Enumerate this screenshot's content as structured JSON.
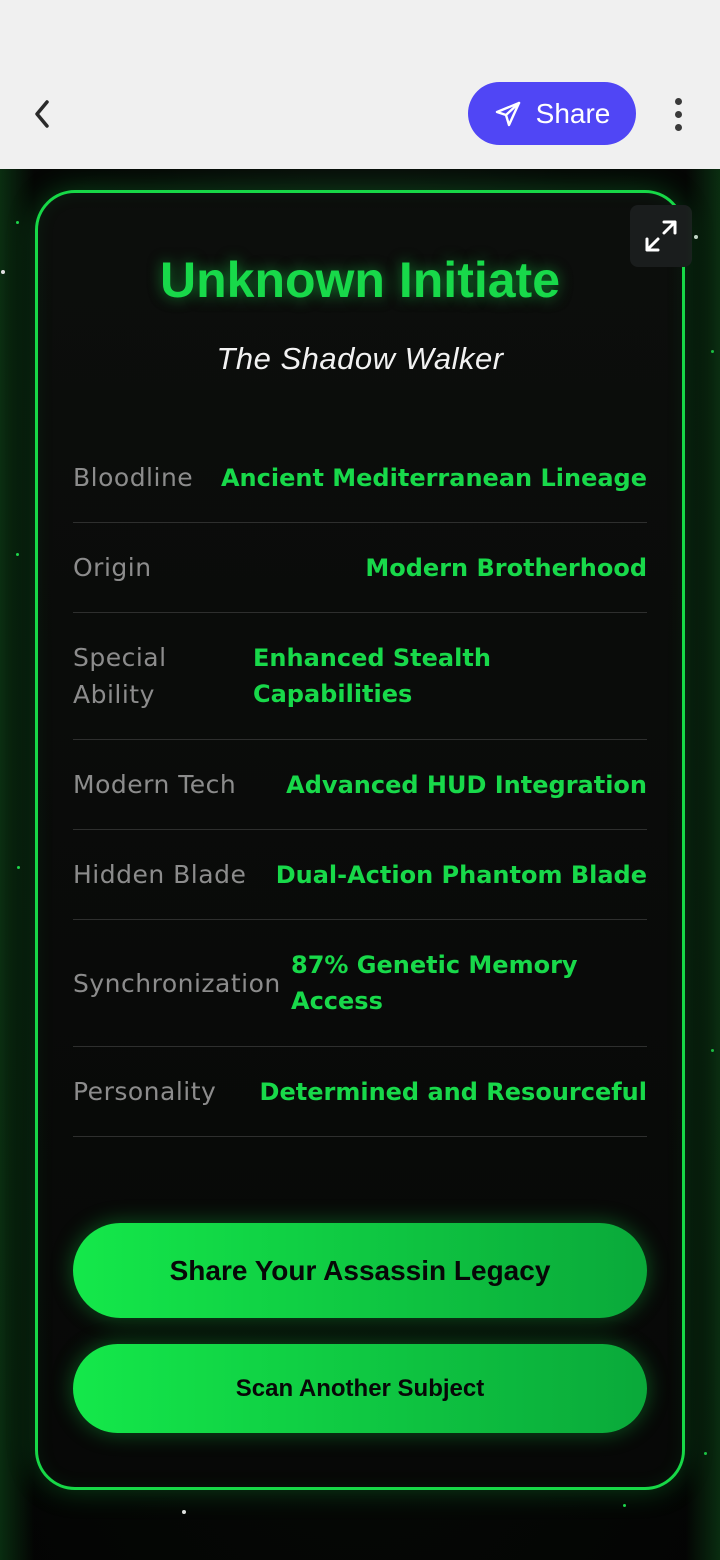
{
  "topbar": {
    "back_icon": "chevron-left-icon",
    "share_label": "Share",
    "share_icon": "send-icon",
    "more_icon": "more-vertical-icon"
  },
  "card": {
    "title": "Unknown Initiate",
    "subtitle": "The Shadow Walker",
    "expand_icon": "expand-icon",
    "accent_color": "#18d94a",
    "traits": [
      {
        "label": "Bloodline",
        "value": "Ancient Mediterranean Lineage"
      },
      {
        "label": "Origin",
        "value": "Modern Brotherhood"
      },
      {
        "label": "Special Ability",
        "value": "Enhanced Stealth Capabilities"
      },
      {
        "label": "Modern Tech",
        "value": "Advanced HUD Integration"
      },
      {
        "label": "Hidden Blade",
        "value": "Dual-Action Phantom Blade"
      },
      {
        "label": "Synchronization",
        "value": "87% Genetic Memory Access"
      },
      {
        "label": "Personality",
        "value": "Determined and Resourceful"
      }
    ],
    "primary_button": "Share Your Assassin Legacy",
    "secondary_button": "Scan Another Subject"
  },
  "colors": {
    "share_button": "#5046f5",
    "accent": "#18d94a",
    "background": "#060806"
  }
}
